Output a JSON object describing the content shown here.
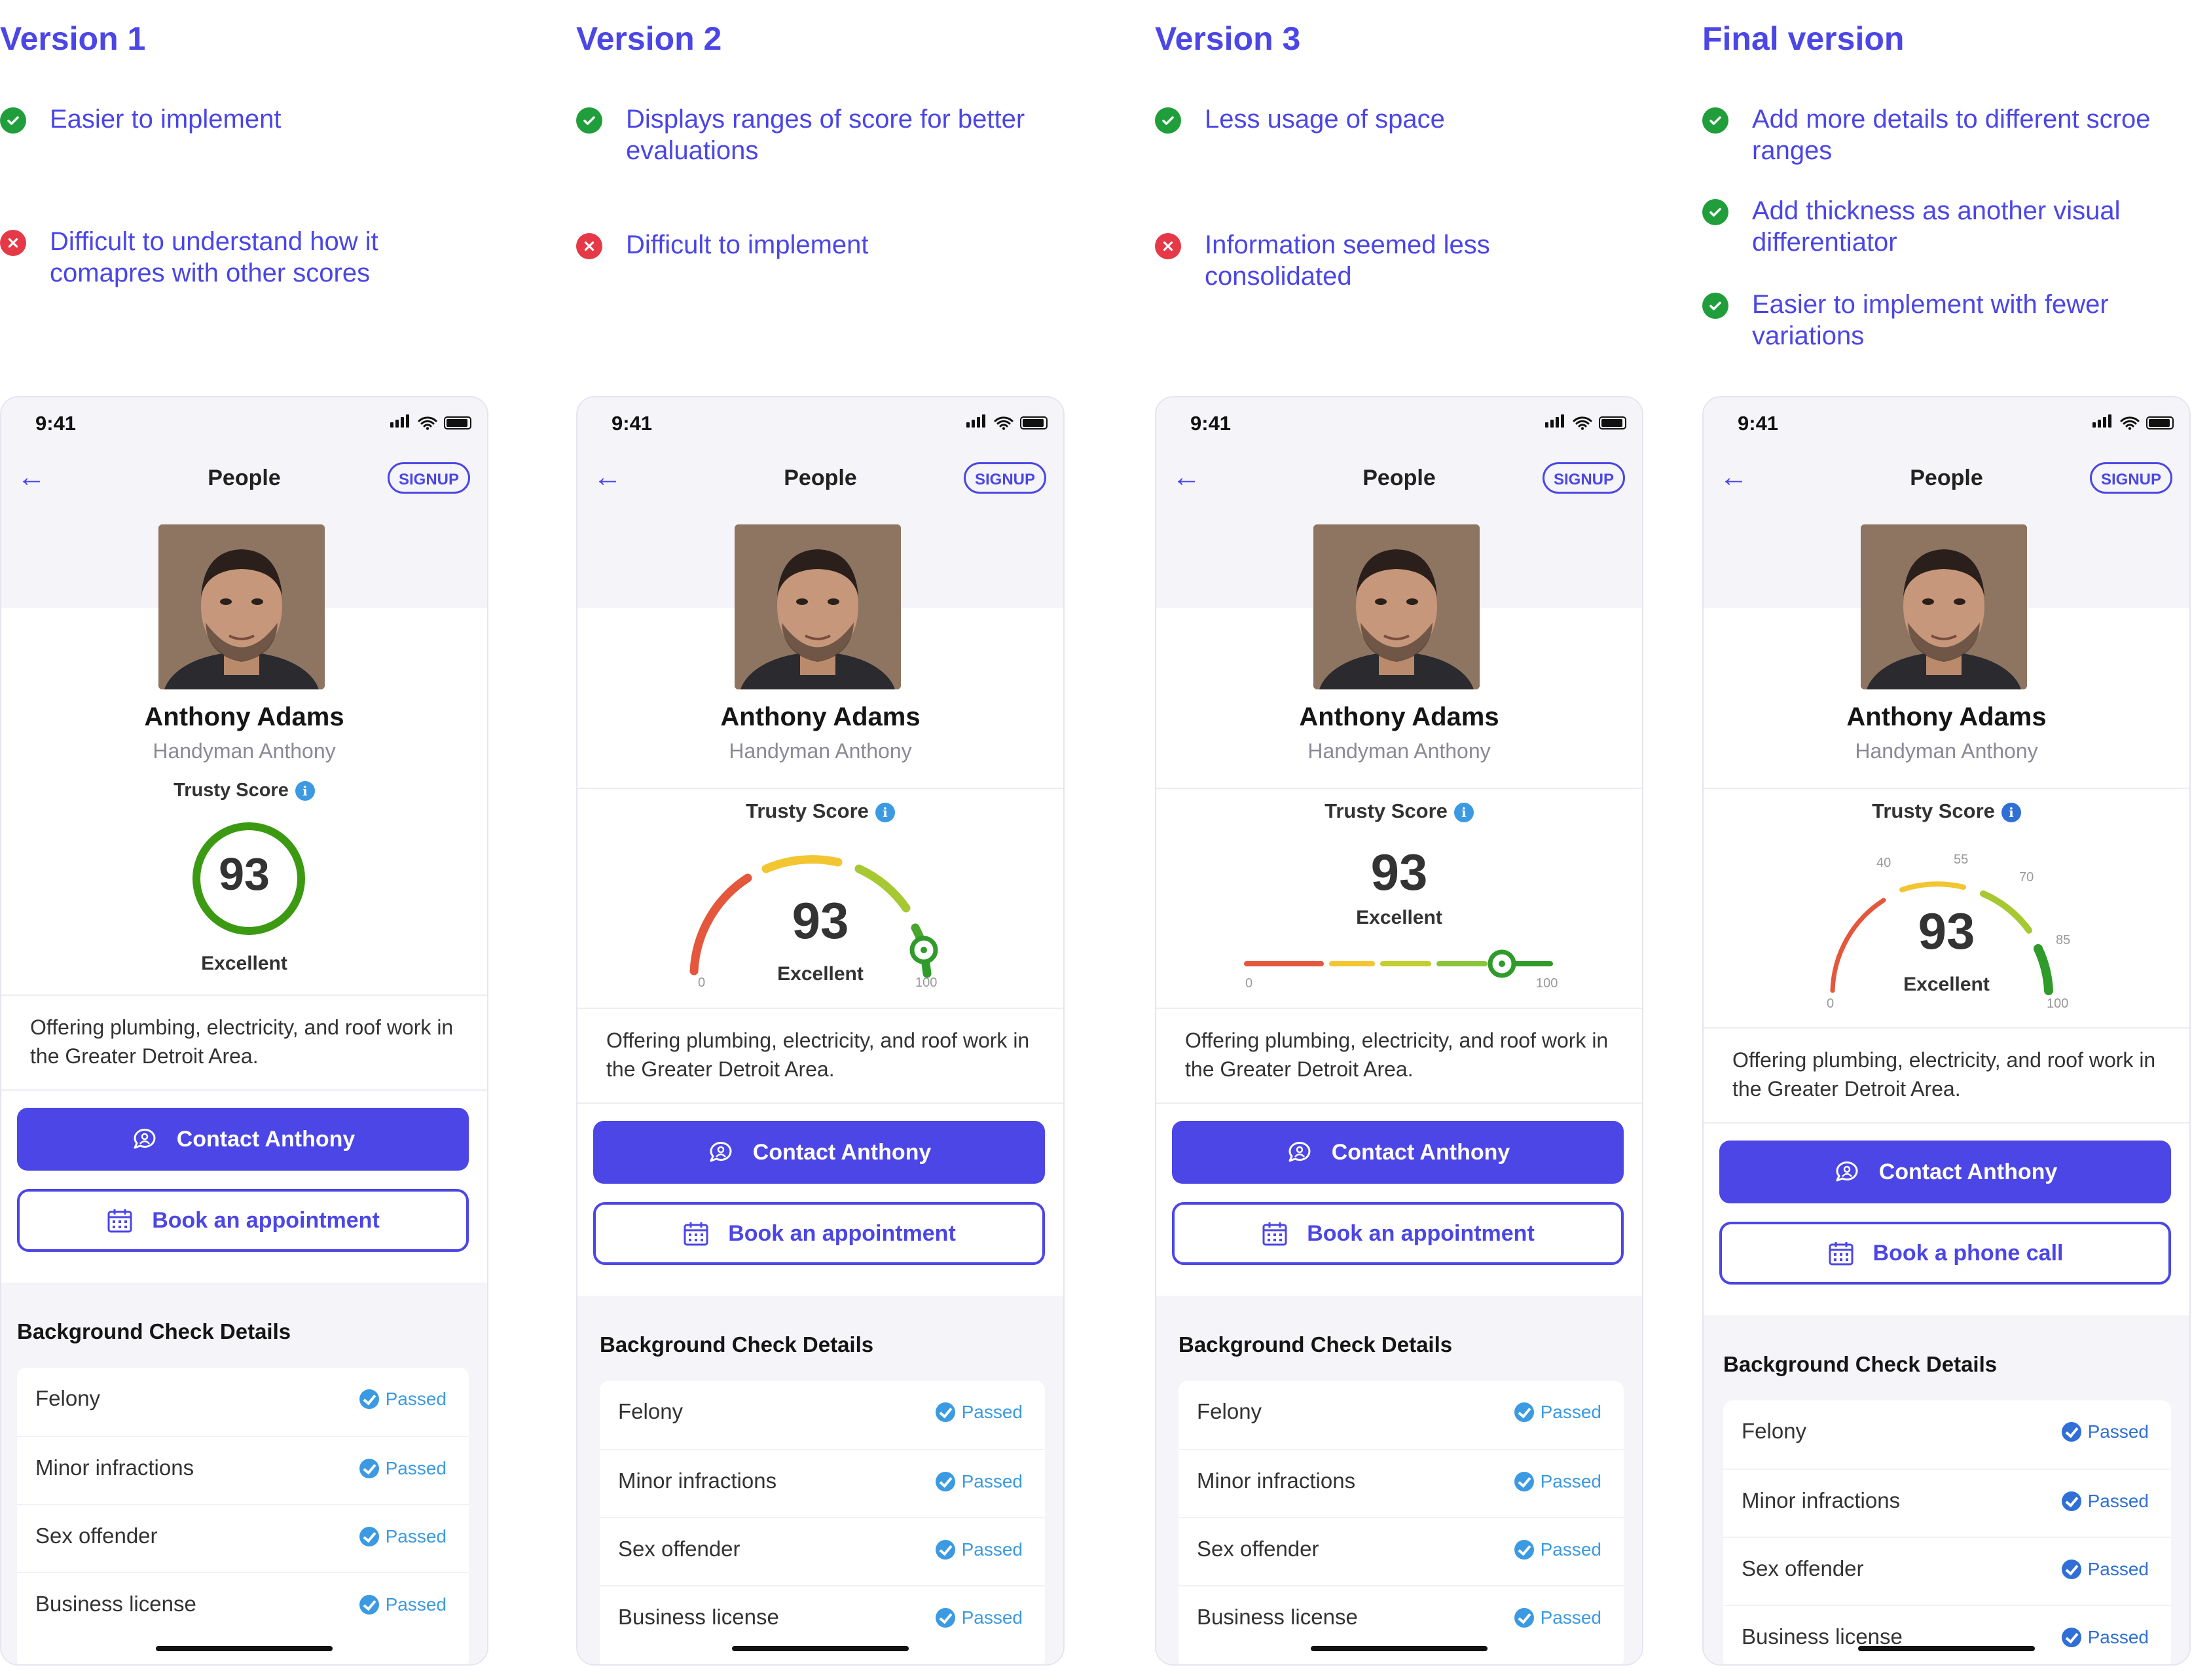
{
  "colors": {
    "accent": "#4b46e5",
    "positive": "#1f9e3b",
    "negative": "#e53948",
    "passed": "#3b9ae1"
  },
  "versions": [
    {
      "title": "Version 1",
      "notes": [
        {
          "type": "pro",
          "text": "Easier to implement"
        },
        {
          "type": "con",
          "text": "Difficult to understand how it comapres with other scores"
        }
      ]
    },
    {
      "title": "Version 2",
      "notes": [
        {
          "type": "pro",
          "text": "Displays ranges of score for better evaluations"
        },
        {
          "type": "con",
          "text": "Difficult to implement"
        }
      ]
    },
    {
      "title": "Version 3",
      "notes": [
        {
          "type": "pro",
          "text": "Less usage of space"
        },
        {
          "type": "con",
          "text": "Information seemed less consolidated"
        }
      ]
    },
    {
      "title": "Final version",
      "notes": [
        {
          "type": "pro",
          "text": "Add more details to different scroe ranges"
        },
        {
          "type": "pro",
          "text": "Add thickness as another visual differentiator"
        },
        {
          "type": "pro",
          "text": "Easier to implement with fewer variations"
        }
      ]
    }
  ],
  "phone": {
    "time": "9:41",
    "nav_title": "People",
    "signup_label": "SIGNUP",
    "name": "Anthony Adams",
    "handle": "Handyman Anthony",
    "score_title": "Trusty Score",
    "score": 93,
    "score_label": "Excellent",
    "description": "Offering plumbing, electricity, and roof work in the Greater Detroit Area.",
    "contact_label": "Contact Anthony",
    "book_label": "Book an appointment",
    "book_label_final": "Book a phone call",
    "bg_title": "Background Check Details",
    "checks": [
      {
        "label": "Felony",
        "status": "Passed"
      },
      {
        "label": "Minor infractions",
        "status": "Passed"
      },
      {
        "label": "Sex offender",
        "status": "Passed"
      },
      {
        "label": "Business license",
        "status": "Passed"
      }
    ],
    "gauge_ticks": {
      "min": "0",
      "max": "100",
      "final": [
        "40",
        "55",
        "70",
        "85"
      ]
    }
  }
}
